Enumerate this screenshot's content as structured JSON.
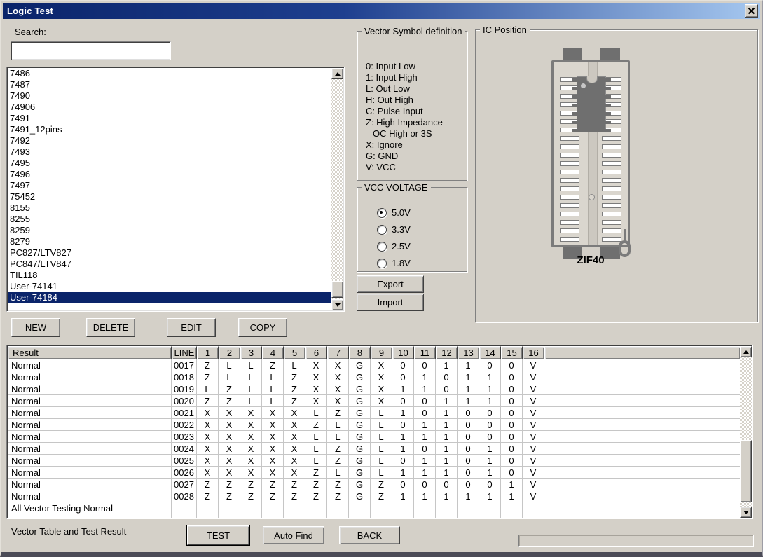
{
  "window": {
    "title": "Logic Test"
  },
  "search": {
    "label": "Search:",
    "value": ""
  },
  "device_list": {
    "items": [
      "7486",
      "7487",
      "7490",
      "74906",
      "7491",
      "7491_12pins",
      "7492",
      "7493",
      "7495",
      "7496",
      "7497",
      "75452",
      "8155",
      "8255",
      "8259",
      "8279",
      "PC827/LTV827",
      "PC847/LTV847",
      "TIL118",
      "User-74141",
      "User-74184"
    ],
    "selected_index": 20,
    "selected_item": "User-74184"
  },
  "actions": {
    "new": "NEW",
    "del": "DELETE",
    "edit": "EDIT",
    "copy": "COPY"
  },
  "vector_symbols": {
    "title": "Vector Symbol definition",
    "lines": [
      "0: Input Low",
      "1: Input High",
      "L: Out Low",
      "H: Out High",
      "C: Pulse Input",
      "Z: High Impedance",
      "OC High or 3S",
      "X: Ignore",
      "G: GND",
      "V: VCC"
    ]
  },
  "vcc": {
    "title": "VCC VOLTAGE",
    "options": [
      "5.0V",
      "3.3V",
      "2.5V",
      "1.8V"
    ],
    "selected": "5.0V"
  },
  "transfer": {
    "export": "Export",
    "import": "Import"
  },
  "ic_position": {
    "title": "IC Position",
    "socket_label": "ZIF40",
    "pin_slots_per_side": 20,
    "chip_stub_rows": 7
  },
  "results": {
    "headers": [
      "Result",
      "LINE",
      "1",
      "2",
      "3",
      "4",
      "5",
      "6",
      "7",
      "8",
      "9",
      "10",
      "11",
      "12",
      "13",
      "14",
      "15",
      "16"
    ],
    "rows": [
      {
        "result": "Normal",
        "line": "0017",
        "v": [
          "Z",
          "L",
          "L",
          "Z",
          "L",
          "X",
          "X",
          "G",
          "X",
          "0",
          "0",
          "1",
          "1",
          "0",
          "0",
          "V"
        ]
      },
      {
        "result": "Normal",
        "line": "0018",
        "v": [
          "Z",
          "L",
          "L",
          "L",
          "Z",
          "X",
          "X",
          "G",
          "X",
          "0",
          "1",
          "0",
          "1",
          "1",
          "0",
          "V"
        ]
      },
      {
        "result": "Normal",
        "line": "0019",
        "v": [
          "L",
          "Z",
          "L",
          "L",
          "Z",
          "X",
          "X",
          "G",
          "X",
          "1",
          "1",
          "0",
          "1",
          "1",
          "0",
          "V"
        ]
      },
      {
        "result": "Normal",
        "line": "0020",
        "v": [
          "Z",
          "Z",
          "L",
          "L",
          "Z",
          "X",
          "X",
          "G",
          "X",
          "0",
          "0",
          "1",
          "1",
          "1",
          "0",
          "V"
        ]
      },
      {
        "result": "Normal",
        "line": "0021",
        "v": [
          "X",
          "X",
          "X",
          "X",
          "X",
          "L",
          "Z",
          "G",
          "L",
          "1",
          "0",
          "1",
          "0",
          "0",
          "0",
          "V"
        ]
      },
      {
        "result": "Normal",
        "line": "0022",
        "v": [
          "X",
          "X",
          "X",
          "X",
          "X",
          "Z",
          "L",
          "G",
          "L",
          "0",
          "1",
          "1",
          "0",
          "0",
          "0",
          "V"
        ]
      },
      {
        "result": "Normal",
        "line": "0023",
        "v": [
          "X",
          "X",
          "X",
          "X",
          "X",
          "L",
          "L",
          "G",
          "L",
          "1",
          "1",
          "1",
          "0",
          "0",
          "0",
          "V"
        ]
      },
      {
        "result": "Normal",
        "line": "0024",
        "v": [
          "X",
          "X",
          "X",
          "X",
          "X",
          "L",
          "Z",
          "G",
          "L",
          "1",
          "0",
          "1",
          "0",
          "1",
          "0",
          "V"
        ]
      },
      {
        "result": "Normal",
        "line": "0025",
        "v": [
          "X",
          "X",
          "X",
          "X",
          "X",
          "L",
          "Z",
          "G",
          "L",
          "0",
          "1",
          "1",
          "0",
          "1",
          "0",
          "V"
        ]
      },
      {
        "result": "Normal",
        "line": "0026",
        "v": [
          "X",
          "X",
          "X",
          "X",
          "X",
          "Z",
          "L",
          "G",
          "L",
          "1",
          "1",
          "1",
          "0",
          "1",
          "0",
          "V"
        ]
      },
      {
        "result": "Normal",
        "line": "0027",
        "v": [
          "Z",
          "Z",
          "Z",
          "Z",
          "Z",
          "Z",
          "Z",
          "G",
          "Z",
          "0",
          "0",
          "0",
          "0",
          "0",
          "1",
          "V"
        ]
      },
      {
        "result": "Normal",
        "line": "0028",
        "v": [
          "Z",
          "Z",
          "Z",
          "Z",
          "Z",
          "Z",
          "Z",
          "G",
          "Z",
          "1",
          "1",
          "1",
          "1",
          "1",
          "1",
          "V"
        ]
      }
    ],
    "summary": "All Vector Testing Normal"
  },
  "footer": {
    "status": "Vector Table and Test Result",
    "test": "TEST",
    "auto_find": "Auto Find",
    "back": "BACK"
  },
  "colors": {
    "face": "#d4d0c8",
    "selection_bg": "#0a246a",
    "selection_fg": "#ffffff",
    "titlebar_from": "#0a246a",
    "titlebar_to": "#a6c8f0"
  }
}
